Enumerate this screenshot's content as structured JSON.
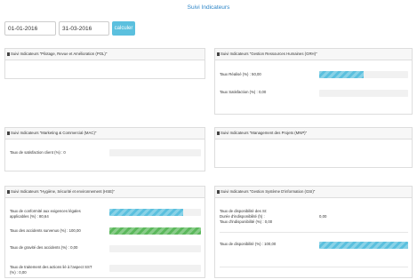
{
  "page": {
    "title": "Suivi Indicateurs "
  },
  "filters": {
    "date_from": "01-01-2016",
    "date_to": "31-03-2016",
    "submit_label": "calculer"
  },
  "colors": {
    "accent": "#2e86c8",
    "info": "#5bc0de",
    "success": "#5cb85c"
  },
  "panels": {
    "pol": {
      "title": "Suivi Indicateurs \"Pilotage, Revue et Amélioration (POL)\""
    },
    "grh": {
      "title": "Suivi Indicateurs \"Gestion Ressources Humaines (GRH)\"",
      "rows": [
        {
          "label": "Taux Réalisé (%) : 50,00",
          "progress": 50,
          "color": "blue"
        },
        {
          "label": "Taux Satisfaction (%) : 0,00",
          "progress": 0,
          "color": "blue"
        }
      ]
    },
    "mac": {
      "title": "Suivi Indicateurs \"Marketing & Commercial (MAC)\"",
      "rows": [
        {
          "label": "Taux de satisfaction client (%) : 0",
          "progress": 0,
          "color": "blue"
        }
      ]
    },
    "mnp": {
      "title": "Suivi Indicateurs \"Management des Projets (MNP)\""
    },
    "hse": {
      "title": "Suivi Indicateurs \"Hygiène, Sécurité et environnement (HSE)\"",
      "rows": [
        {
          "label_line1": "Taux de conformité aux exigences légales",
          "label_line2": "applicables (%) : 80,64",
          "progress": 80.64,
          "color": "blue"
        },
        {
          "label": "Taux des accidents survenus (%) : 100,00",
          "progress": 100,
          "color": "green"
        },
        {
          "label": "Taux de gravité des accidents (%) : 0,00",
          "progress": 0,
          "color": "blue"
        },
        {
          "label_line1": "Taux de traitement des actions lié à l'aspect SST",
          "label_line2": "(%) : 0,00",
          "progress": 0,
          "color": "blue"
        }
      ]
    },
    "gsi": {
      "title": "Suivi Indicateurs \"Gestion Système D'information (GSI)\"",
      "availability_title": "Taux de disponibilité des SI:",
      "downtime_label": "Durée d'indisponibilité (h) :",
      "downtime_value": "0,00",
      "unavailability_label": "Taux d'indisponibilité (%) : 0,00",
      "availability_label": "Taux de disponibilité (%) : 100,00",
      "availability_progress": 100,
      "availability_color": "blue"
    }
  }
}
